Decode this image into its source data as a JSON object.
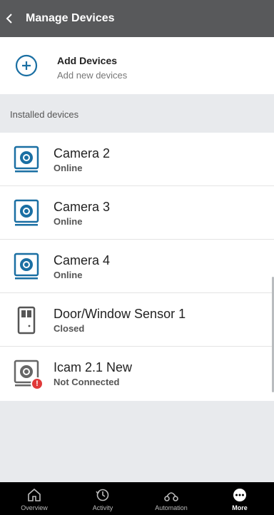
{
  "header": {
    "title": "Manage Devices",
    "back_icon": "chevron-left-icon"
  },
  "add_devices": {
    "title": "Add Devices",
    "subtitle": "Add new devices",
    "icon": "plus-circle-icon"
  },
  "section": {
    "label": "Installed devices"
  },
  "devices": [
    {
      "name": "Camera 2",
      "status": "Online",
      "icon": "camera-icon"
    },
    {
      "name": "Camera 3",
      "status": "Online",
      "icon": "camera-icon"
    },
    {
      "name": "Camera 4",
      "status": "Online",
      "icon": "camera-icon"
    },
    {
      "name": "Door/Window Sensor 1",
      "status": "Closed",
      "icon": "door-sensor-icon"
    },
    {
      "name": "Icam 2.1 New",
      "status": "Not Connected",
      "icon": "camera-disconnected-icon",
      "alert": "!"
    }
  ],
  "tabs": [
    {
      "label": "Overview",
      "icon": "home-icon"
    },
    {
      "label": "Activity",
      "icon": "history-icon"
    },
    {
      "label": "Automation",
      "icon": "automation-icon"
    },
    {
      "label": "More",
      "icon": "more-icon",
      "active": true
    }
  ],
  "colors": {
    "accent": "#1a6fa3",
    "header": "#58595b",
    "alert": "#e03a3a"
  }
}
